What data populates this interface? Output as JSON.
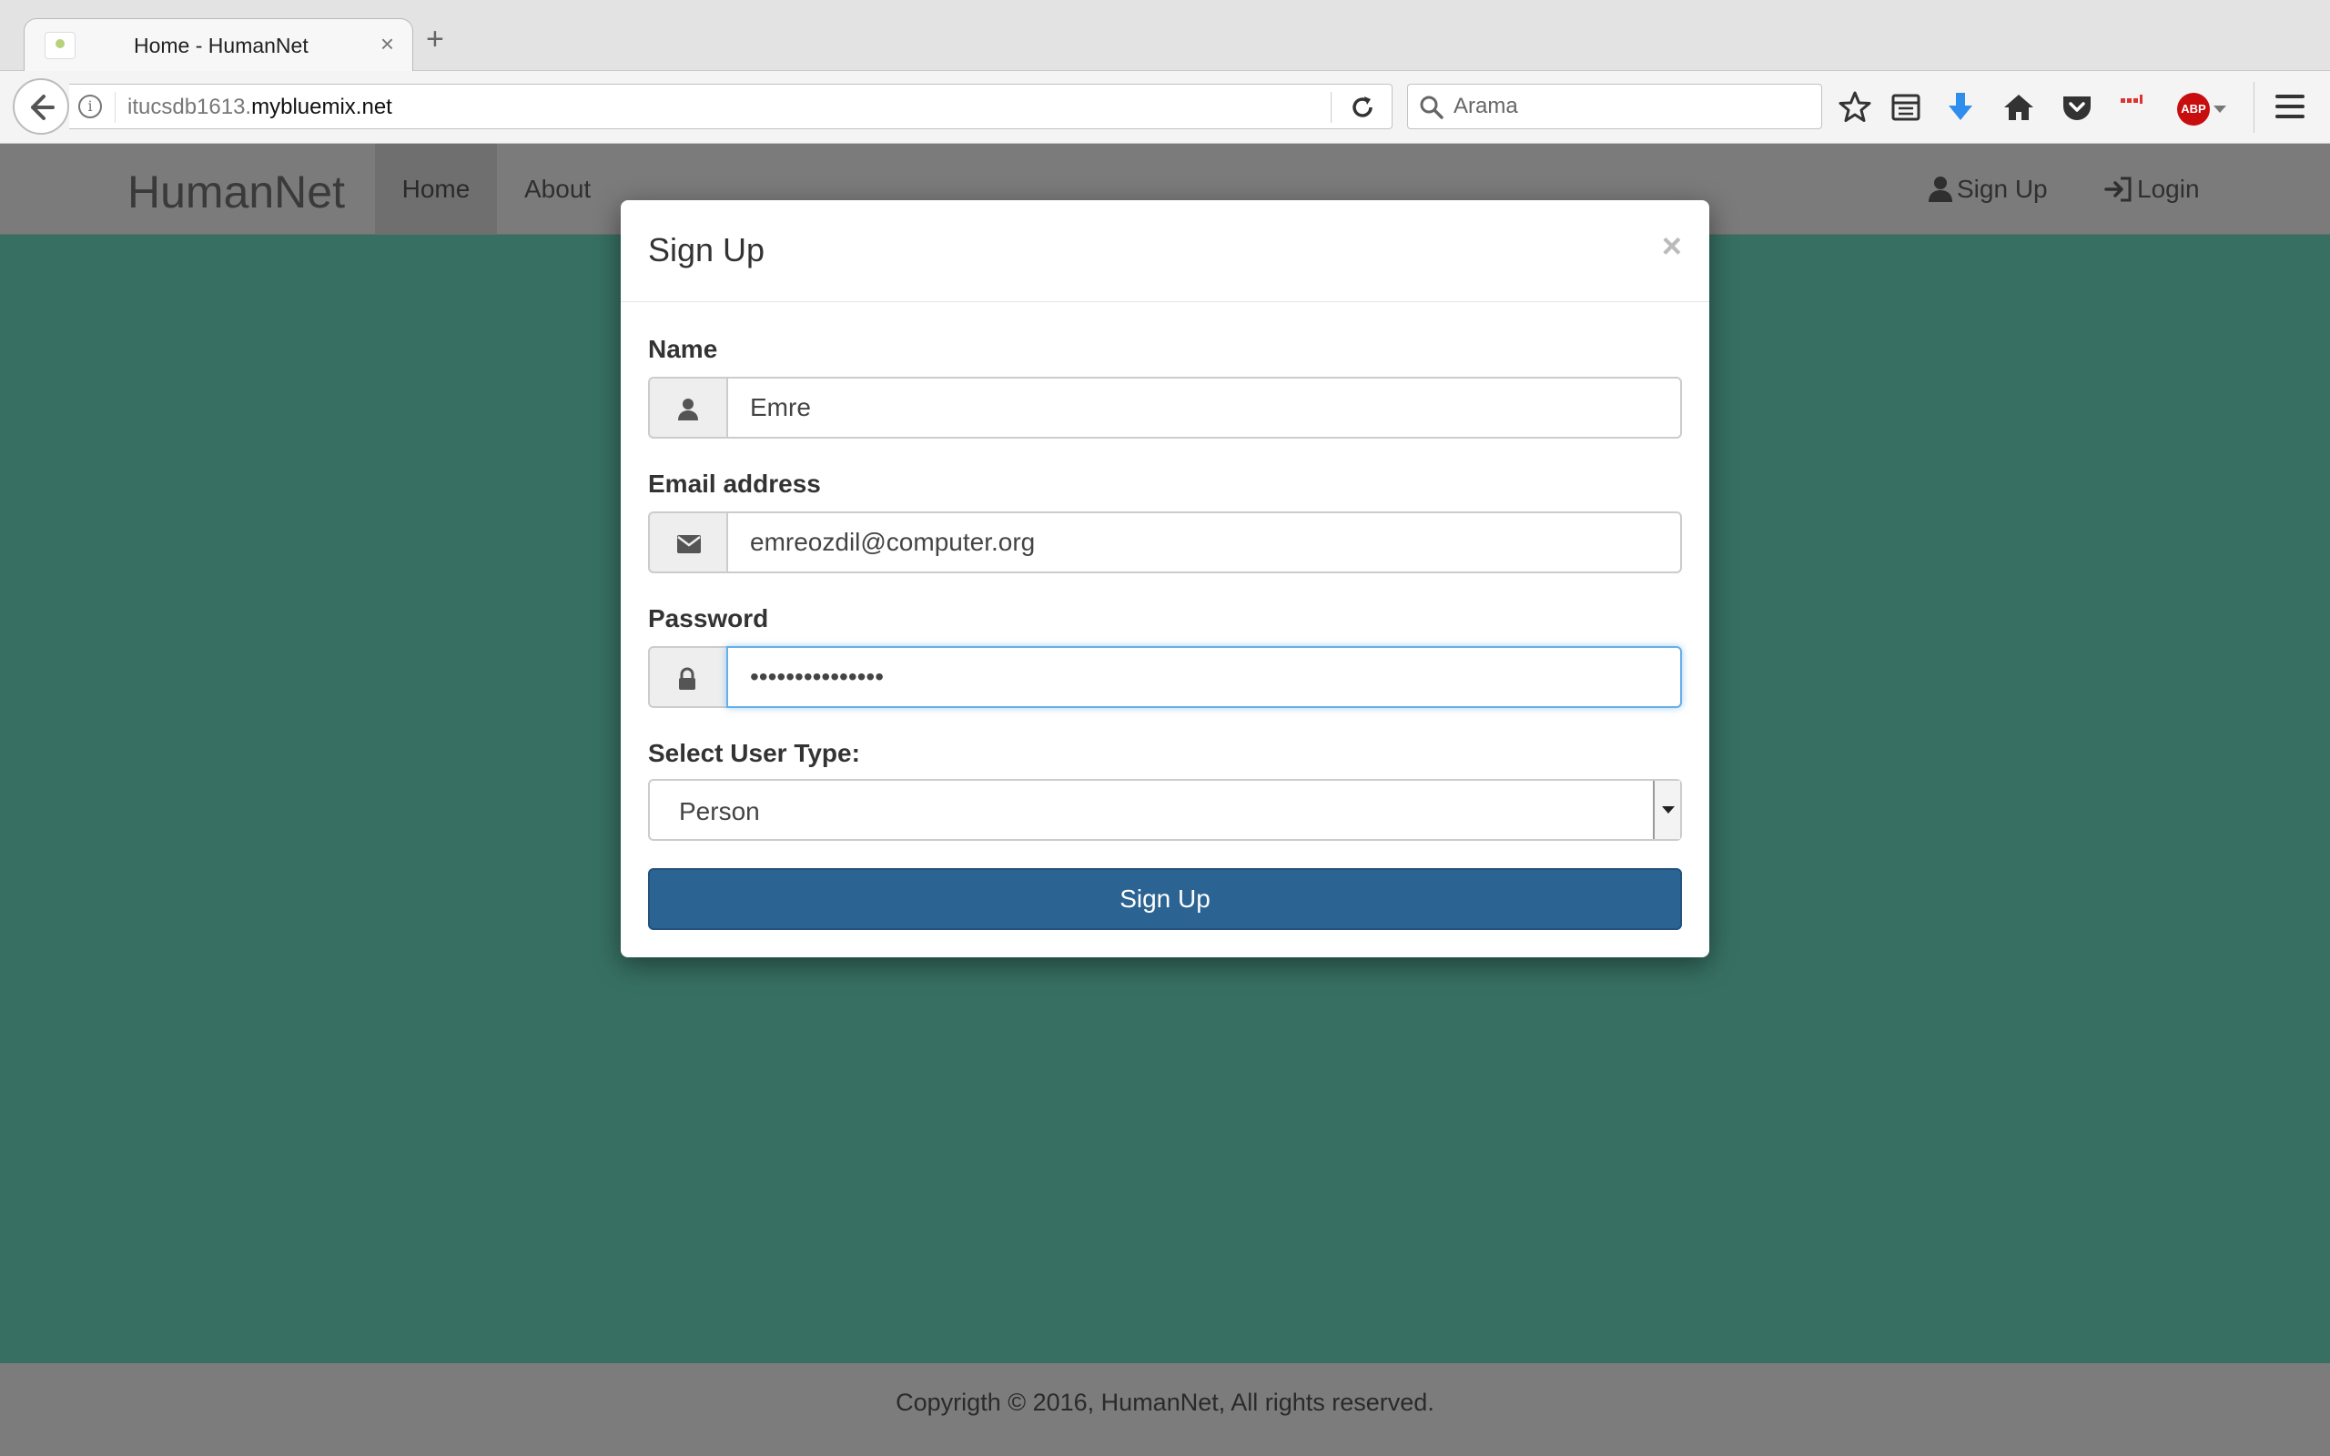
{
  "browser": {
    "tab_title": "Home - HumanNet",
    "tab_close": "×",
    "new_tab": "+",
    "url_prefix": "itucsdb1613.",
    "url_domain": "mybluemix.net",
    "search_placeholder": "Arama",
    "abp_label": "ABP"
  },
  "site_nav": {
    "brand": "HumanNet",
    "home": "Home",
    "about": "About",
    "signup": "Sign Up",
    "login": "Login"
  },
  "modal": {
    "title": "Sign Up",
    "close": "×",
    "name_label": "Name",
    "name_value": "Emre",
    "email_label": "Email address",
    "email_value": "emreozdil@computer.org",
    "password_label": "Password",
    "password_value": "•••••••••••••••",
    "user_type_label": "Select User Type:",
    "user_type_value": "Person",
    "submit_label": "Sign Up"
  },
  "footer": {
    "text": "Copyrigth  ©  2016, HumanNet, All rights reserved."
  },
  "colors": {
    "background": "#377063",
    "primary_button": "#2b6393",
    "navbar": "#7b7b7b"
  }
}
